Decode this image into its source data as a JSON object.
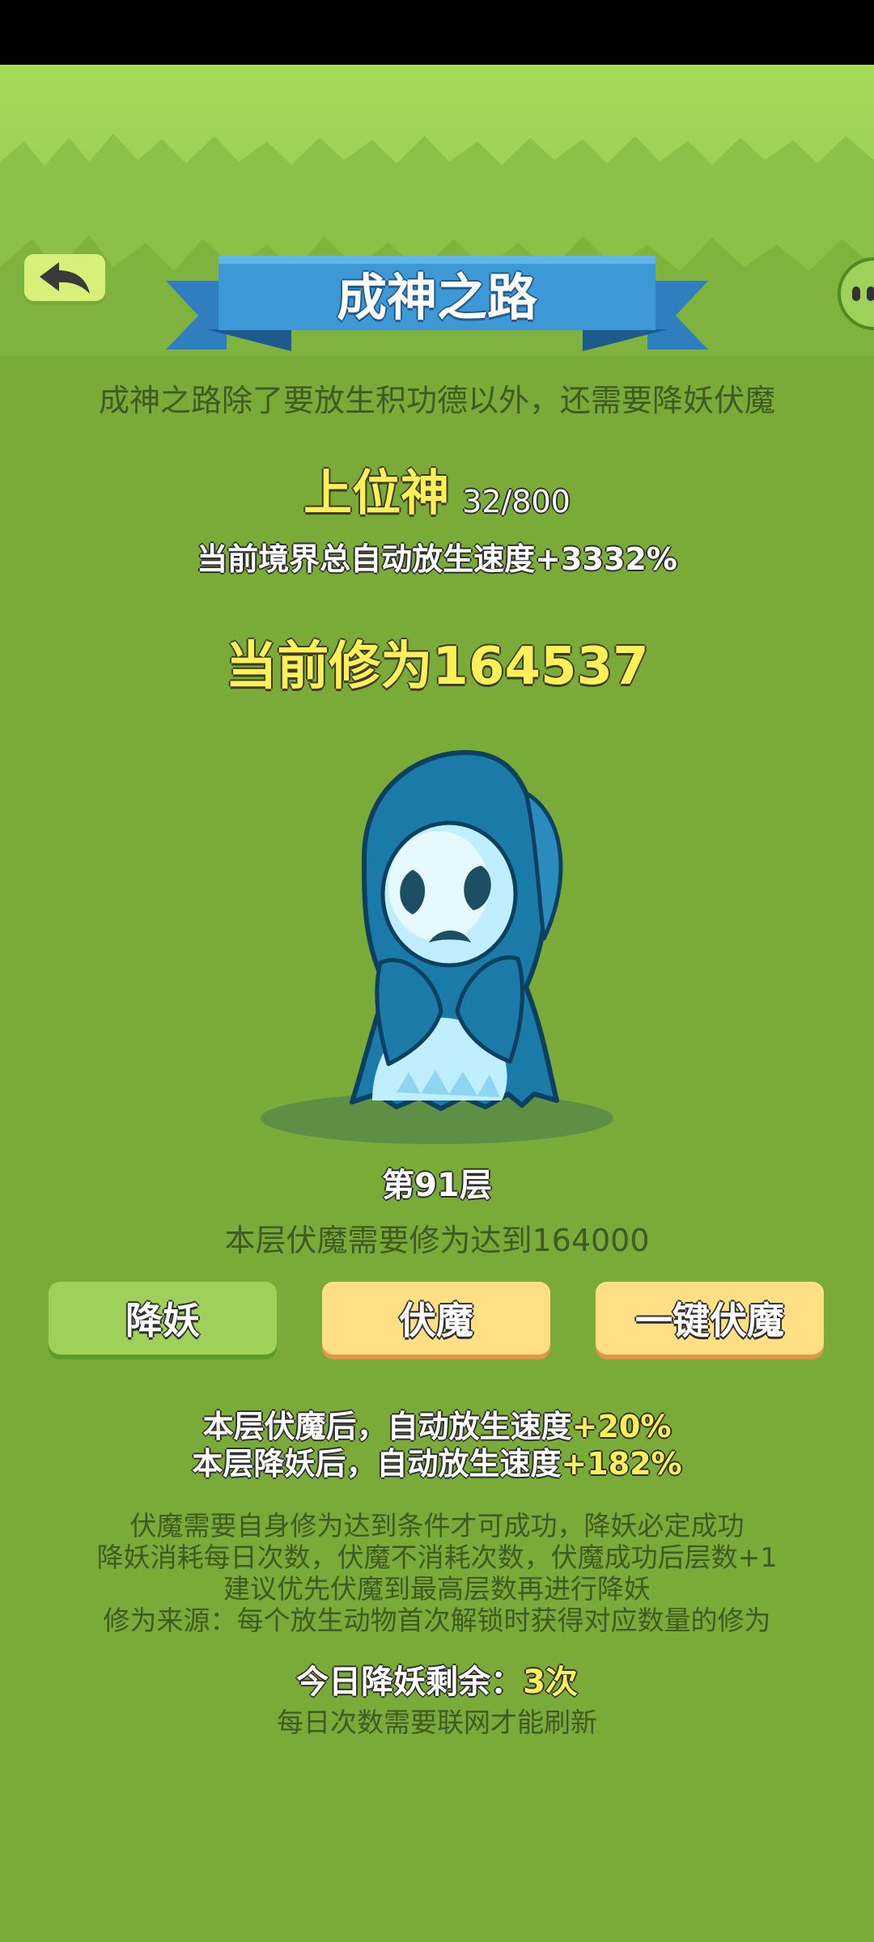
{
  "header": {
    "title": "成神之路"
  },
  "intro": "成神之路除了要放生积功德以外，还需要降妖伏魔",
  "rank": {
    "name": "上位神",
    "progress": "32/800",
    "speed_text": "当前境界总自动放生速度+3332%"
  },
  "cultivation": {
    "label": "当前修为",
    "value": "164537"
  },
  "floor": {
    "label": "第91层",
    "requirement": "本层伏魔需要修为达到164000"
  },
  "buttons": {
    "subdue_demon": "降妖",
    "conquer_demon": "伏魔",
    "one_key_conquer": "一键伏魔"
  },
  "effects": {
    "conquer_prefix": "本层伏魔后，自动放生速度",
    "conquer_value": "+20%",
    "subdue_prefix": "本层降妖后，自动放生速度",
    "subdue_value": "+182%"
  },
  "rules": [
    "伏魔需要自身修为达到条件才可成功，降妖必定成功",
    "降妖消耗每日次数，伏魔不消耗次数，伏魔成功后层数+1",
    "建议优先伏魔到最高层数再进行降妖",
    "修为来源：每个放生动物首次解锁时获得对应数量的修为"
  ],
  "remaining": {
    "label": "今日降妖剩余：",
    "value": "3次"
  },
  "network_note": "每日次数需要联网才能刷新",
  "icons": {
    "back": "back-arrow-icon",
    "side": "side-menu-icon",
    "monster": "ghost-monster"
  },
  "colors": {
    "background": "#7aaa38",
    "highlight": "#fff05a",
    "ribbon": "#3d98d6"
  }
}
